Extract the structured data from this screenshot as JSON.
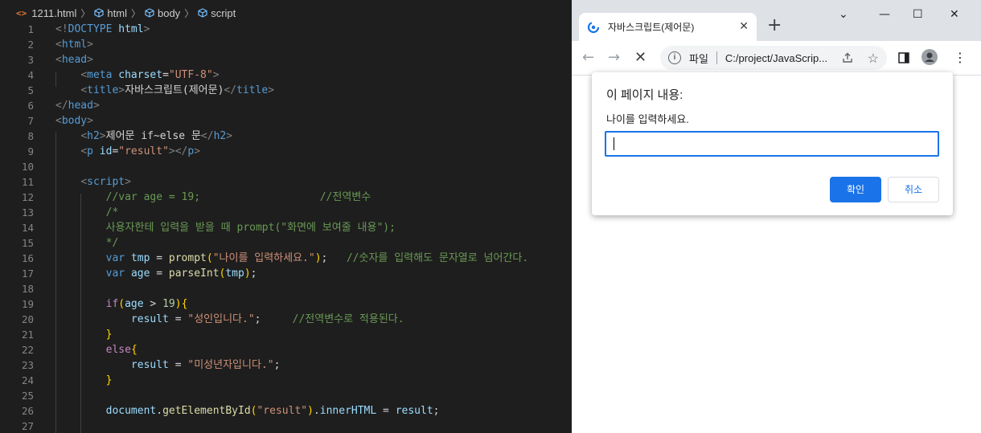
{
  "editor": {
    "breadcrumb": {
      "file": "1211.html",
      "path": [
        "html",
        "body",
        "script"
      ]
    },
    "line_numbers": [
      "1",
      "2",
      "3",
      "4",
      "5",
      "6",
      "7",
      "8",
      "9",
      "10",
      "11",
      "12",
      "13",
      "14",
      "15",
      "16",
      "17",
      "18",
      "19",
      "20",
      "21",
      "22",
      "23",
      "24",
      "25",
      "26",
      "27"
    ],
    "lines": [
      [
        [
          "tg",
          "<!"
        ],
        [
          "tn",
          "DOCTYPE"
        ],
        [
          "tx",
          " "
        ],
        [
          "at",
          "html"
        ],
        [
          "tg",
          ">"
        ]
      ],
      [
        [
          "tg",
          "<"
        ],
        [
          "tn",
          "html"
        ],
        [
          "tg",
          ">"
        ]
      ],
      [
        [
          "tg",
          "<"
        ],
        [
          "tn",
          "head"
        ],
        [
          "tg",
          ">"
        ]
      ],
      [
        [
          "tx",
          "    "
        ],
        [
          "tg",
          "<"
        ],
        [
          "tn",
          "meta"
        ],
        [
          "tx",
          " "
        ],
        [
          "at",
          "charset"
        ],
        [
          "pn",
          "="
        ],
        [
          "st",
          "\"UTF-8\""
        ],
        [
          "tg",
          ">"
        ]
      ],
      [
        [
          "tx",
          "    "
        ],
        [
          "tg",
          "<"
        ],
        [
          "tn",
          "title"
        ],
        [
          "tg",
          ">"
        ],
        [
          "tx",
          "자바스크립트(제어문)"
        ],
        [
          "tg",
          "</"
        ],
        [
          "tn",
          "title"
        ],
        [
          "tg",
          ">"
        ]
      ],
      [
        [
          "tg",
          "</"
        ],
        [
          "tn",
          "head"
        ],
        [
          "tg",
          ">"
        ]
      ],
      [
        [
          "tg",
          "<"
        ],
        [
          "tn",
          "body"
        ],
        [
          "tg",
          ">"
        ]
      ],
      [
        [
          "tx",
          "    "
        ],
        [
          "tg",
          "<"
        ],
        [
          "tn",
          "h2"
        ],
        [
          "tg",
          ">"
        ],
        [
          "tx",
          "제어문 if~else 문"
        ],
        [
          "tg",
          "</"
        ],
        [
          "tn",
          "h2"
        ],
        [
          "tg",
          ">"
        ]
      ],
      [
        [
          "tx",
          "    "
        ],
        [
          "tg",
          "<"
        ],
        [
          "tn",
          "p"
        ],
        [
          "tx",
          " "
        ],
        [
          "at",
          "id"
        ],
        [
          "pn",
          "="
        ],
        [
          "st",
          "\"result\""
        ],
        [
          "tg",
          "></"
        ],
        [
          "tn",
          "p"
        ],
        [
          "tg",
          ">"
        ]
      ],
      [],
      [
        [
          "tx",
          "    "
        ],
        [
          "tg",
          "<"
        ],
        [
          "tn",
          "script"
        ],
        [
          "tg",
          ">"
        ]
      ],
      [
        [
          "tx",
          "        "
        ],
        [
          "cm",
          "//var age = 19;                   //전역변수"
        ]
      ],
      [
        [
          "tx",
          "        "
        ],
        [
          "cm",
          "/*"
        ]
      ],
      [
        [
          "tx",
          "        "
        ],
        [
          "cm",
          "사용자한테 입력을 받을 때 prompt(\"화면에 보여줄 내용\");"
        ]
      ],
      [
        [
          "tx",
          "        "
        ],
        [
          "cm",
          "*/"
        ]
      ],
      [
        [
          "tx",
          "        "
        ],
        [
          "kw",
          "var"
        ],
        [
          "tx",
          " "
        ],
        [
          "vr",
          "tmp"
        ],
        [
          "pn",
          " = "
        ],
        [
          "fn",
          "prompt"
        ],
        [
          "br1",
          "("
        ],
        [
          "st",
          "\"나이를 입력하세요.\""
        ],
        [
          "br1",
          ")"
        ],
        [
          "pn",
          ";   "
        ],
        [
          "cm",
          "//숫자를 입력해도 문자열로 넘어간다."
        ]
      ],
      [
        [
          "tx",
          "        "
        ],
        [
          "kw",
          "var"
        ],
        [
          "tx",
          " "
        ],
        [
          "vr",
          "age"
        ],
        [
          "pn",
          " = "
        ],
        [
          "fn",
          "parseInt"
        ],
        [
          "br1",
          "("
        ],
        [
          "vr",
          "tmp"
        ],
        [
          "br1",
          ")"
        ],
        [
          "pn",
          ";"
        ]
      ],
      [],
      [
        [
          "tx",
          "        "
        ],
        [
          "kc",
          "if"
        ],
        [
          "br1",
          "("
        ],
        [
          "vr",
          "age"
        ],
        [
          "pn",
          " > "
        ],
        [
          "nm",
          "19"
        ],
        [
          "br1",
          ")"
        ],
        [
          "br1",
          "{"
        ]
      ],
      [
        [
          "tx",
          "            "
        ],
        [
          "vr",
          "result"
        ],
        [
          "pn",
          " = "
        ],
        [
          "st",
          "\"성인입니다.\""
        ],
        [
          "pn",
          ";     "
        ],
        [
          "cm",
          "//전역변수로 적용된다."
        ]
      ],
      [
        [
          "tx",
          "        "
        ],
        [
          "br1",
          "}"
        ]
      ],
      [
        [
          "tx",
          "        "
        ],
        [
          "kc",
          "else"
        ],
        [
          "br1",
          "{"
        ]
      ],
      [
        [
          "tx",
          "            "
        ],
        [
          "vr",
          "result"
        ],
        [
          "pn",
          " = "
        ],
        [
          "st",
          "\"미성년자입니다.\""
        ],
        [
          "pn",
          ";"
        ]
      ],
      [
        [
          "tx",
          "        "
        ],
        [
          "br1",
          "}"
        ]
      ],
      [],
      [
        [
          "tx",
          "        "
        ],
        [
          "vr",
          "document"
        ],
        [
          "pn",
          "."
        ],
        [
          "fn",
          "getElementById"
        ],
        [
          "br1",
          "("
        ],
        [
          "st",
          "\"result\""
        ],
        [
          "br1",
          ")"
        ],
        [
          "pn",
          "."
        ],
        [
          "vr",
          "innerHTML"
        ],
        [
          "pn",
          " = "
        ],
        [
          "vr",
          "result"
        ],
        [
          "pn",
          ";"
        ]
      ],
      []
    ]
  },
  "browser": {
    "tab_title": "자바스크립트(제어문)",
    "tab_close": "✕",
    "new_tab": "+",
    "window_controls": [
      "⌄",
      "—",
      "☐",
      "✕"
    ],
    "omnibox": {
      "scheme_label": "파일",
      "url": "C:/project/JavaScrip..."
    },
    "dialog": {
      "title": "이 페이지 내용:",
      "message": "나이를 입력하세요.",
      "input_value": "",
      "ok_label": "확인",
      "cancel_label": "취소"
    }
  }
}
